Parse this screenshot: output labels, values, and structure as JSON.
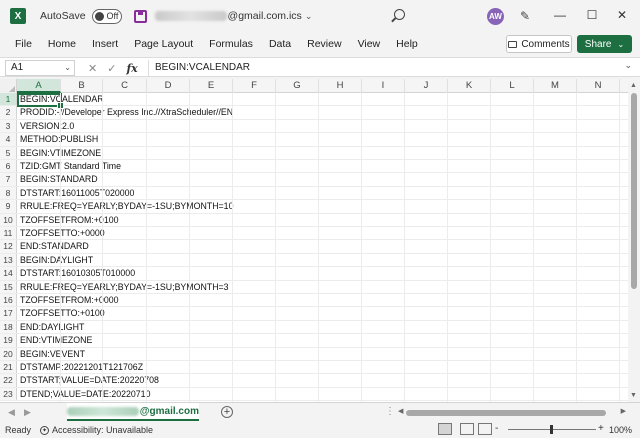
{
  "titlebar": {
    "app_icon": "excel-icon",
    "autosave_label": "AutoSave",
    "autosave_state": "Off",
    "filename_visible": "@gmail.com.ics",
    "avatar_initials": "AW",
    "window_controls": [
      "minimize-icon",
      "maximize-icon",
      "close-icon"
    ]
  },
  "menu": {
    "items": [
      "File",
      "Home",
      "Insert",
      "Page Layout",
      "Formulas",
      "Data",
      "Review",
      "View",
      "Help"
    ],
    "comments_label": "Comments",
    "share_label": "Share"
  },
  "formula_bar": {
    "name_box": "A1",
    "fx_label": "fx",
    "content": "BEGIN:VCALENDAR"
  },
  "grid": {
    "columns": [
      "A",
      "B",
      "C",
      "D",
      "E",
      "F",
      "G",
      "H",
      "I",
      "J",
      "K",
      "L",
      "M",
      "N"
    ],
    "selected_cell": "A1",
    "rows": [
      {
        "num": "1",
        "a": "BEGIN:VCALENDAR"
      },
      {
        "num": "2",
        "a": "PRODID:-//Developer Express Inc.//XtraScheduler//EN"
      },
      {
        "num": "3",
        "a": "VERSION:2.0"
      },
      {
        "num": "4",
        "a": "METHOD:PUBLISH"
      },
      {
        "num": "5",
        "a": "BEGIN:VTIMEZONE"
      },
      {
        "num": "6",
        "a": "TZID:GMT Standard Time"
      },
      {
        "num": "7",
        "a": "BEGIN:STANDARD"
      },
      {
        "num": "8",
        "a": "DTSTART:16011005T020000"
      },
      {
        "num": "9",
        "a": "RRULE:FREQ=YEARLY;BYDAY=-1SU;BYMONTH=10"
      },
      {
        "num": "10",
        "a": "TZOFFSETFROM:+0100"
      },
      {
        "num": "11",
        "a": "TZOFFSETTO:+0000"
      },
      {
        "num": "12",
        "a": "END:STANDARD"
      },
      {
        "num": "13",
        "a": "BEGIN:DAYLIGHT"
      },
      {
        "num": "14",
        "a": "DTSTART:16010305T010000"
      },
      {
        "num": "15",
        "a": "RRULE:FREQ=YEARLY;BYDAY=-1SU;BYMONTH=3"
      },
      {
        "num": "16",
        "a": "TZOFFSETFROM:+0000"
      },
      {
        "num": "17",
        "a": "TZOFFSETTO:+0100"
      },
      {
        "num": "18",
        "a": "END:DAYLIGHT"
      },
      {
        "num": "19",
        "a": "END:VTIMEZONE"
      },
      {
        "num": "20",
        "a": "BEGIN:VEVENT"
      },
      {
        "num": "21",
        "a": "DTSTAMP:20221201T121706Z"
      },
      {
        "num": "22",
        "a": "DTSTART;VALUE=DATE:20220708"
      },
      {
        "num": "23",
        "a": "DTEND;VALUE=DATE:20220710"
      }
    ]
  },
  "sheet_tabs": {
    "active_tab_visible": "@gmail.com",
    "add_sheet_label": "+"
  },
  "status": {
    "ready": "Ready",
    "accessibility": "Accessibility: Unavailable",
    "zoom": "100%",
    "zoom_minus": "-",
    "zoom_plus": "+"
  },
  "colors": {
    "accent": "#1d6f42",
    "avatar_bg": "#8764b8"
  }
}
